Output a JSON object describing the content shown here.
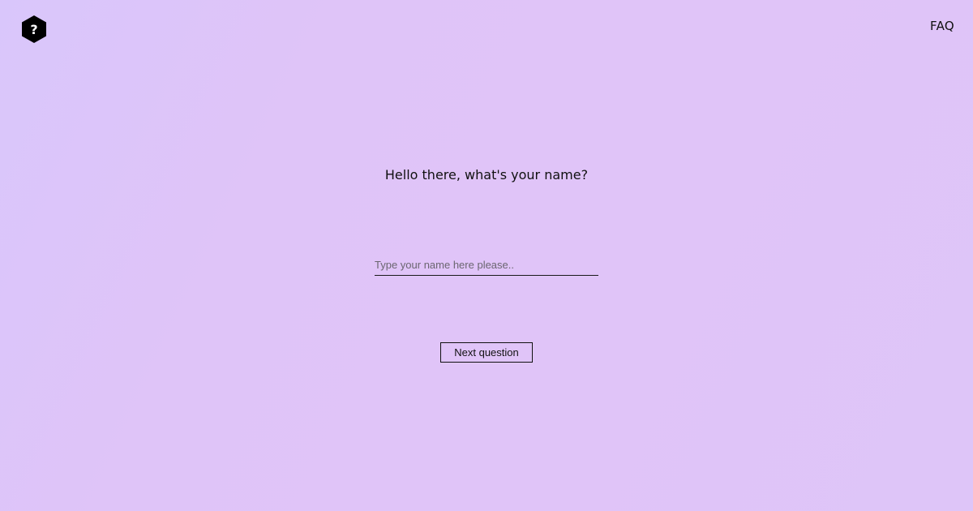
{
  "header": {
    "logo_icon": "question-hexagon-icon",
    "logo_glyph": "?",
    "faq_label": "FAQ"
  },
  "question": {
    "text": "Hello there, what's your name?"
  },
  "name_input": {
    "value": "",
    "placeholder": "Type your name here please.."
  },
  "next_button": {
    "label": "Next question"
  },
  "colors": {
    "background_start": "#d9c6fb",
    "background_end": "#dec5f8",
    "text": "#111111",
    "logo_fill": "#000000",
    "placeholder": "#6b6670"
  }
}
